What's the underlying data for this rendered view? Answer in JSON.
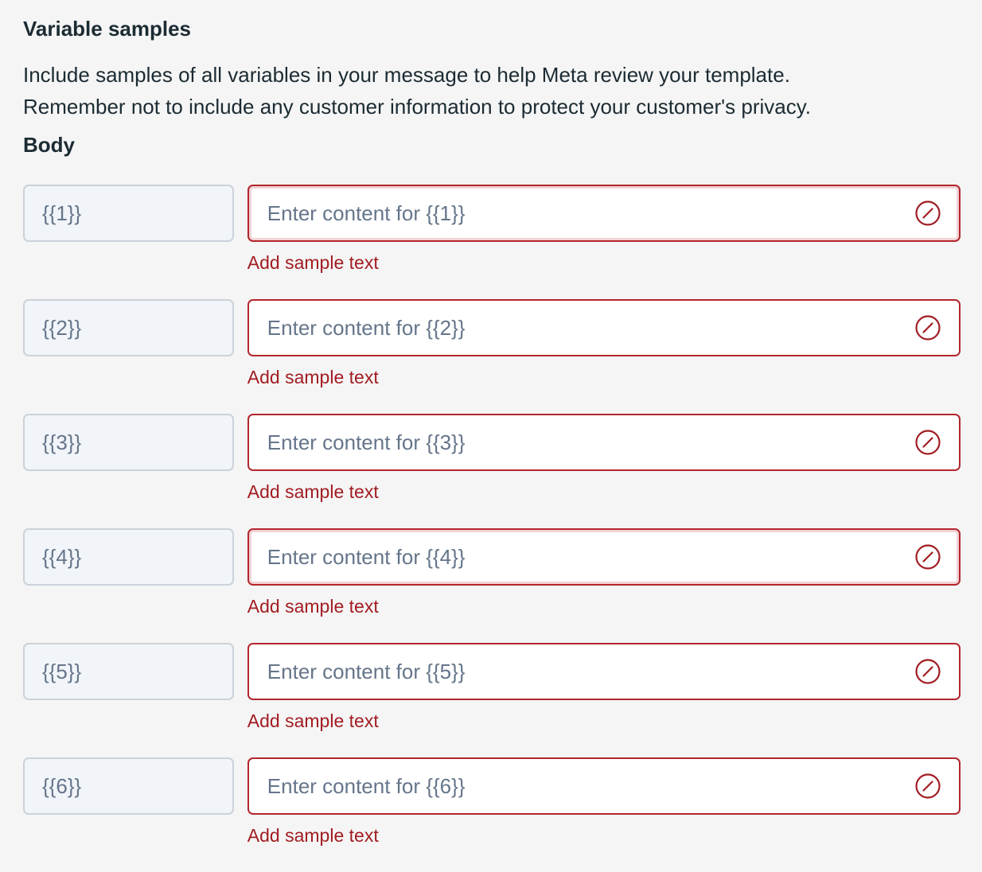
{
  "section": {
    "title": "Variable samples",
    "description_line1": "Include samples of all variables in your message to help Meta review your template.",
    "description_line2": "Remember not to include any customer information to protect your customer's privacy.",
    "body_label": "Body"
  },
  "colors": {
    "error": "#b3262d",
    "error_text": "#a11d22",
    "variable_box_bg": "#f1f4f8",
    "page_bg": "#f5f5f5"
  },
  "variables": [
    {
      "token": "{{1}}",
      "value": "",
      "placeholder": "Enter content for {{1}}",
      "error": "Add sample text",
      "icon": "error-slash-icon"
    },
    {
      "token": "{{2}}",
      "value": "",
      "placeholder": "Enter content for {{2}}",
      "error": "Add sample text",
      "icon": "error-slash-icon"
    },
    {
      "token": "{{3}}",
      "value": "",
      "placeholder": "Enter content for {{3}}",
      "error": "Add sample text",
      "icon": "error-slash-icon"
    },
    {
      "token": "{{4}}",
      "value": "",
      "placeholder": "Enter content for {{4}}",
      "error": "Add sample text",
      "icon": "error-slash-icon"
    },
    {
      "token": "{{5}}",
      "value": "",
      "placeholder": "Enter content for {{5}}",
      "error": "Add sample text",
      "icon": "error-slash-icon"
    },
    {
      "token": "{{6}}",
      "value": "",
      "placeholder": "Enter content for {{6}}",
      "error": "Add sample text",
      "icon": "error-slash-icon"
    }
  ]
}
